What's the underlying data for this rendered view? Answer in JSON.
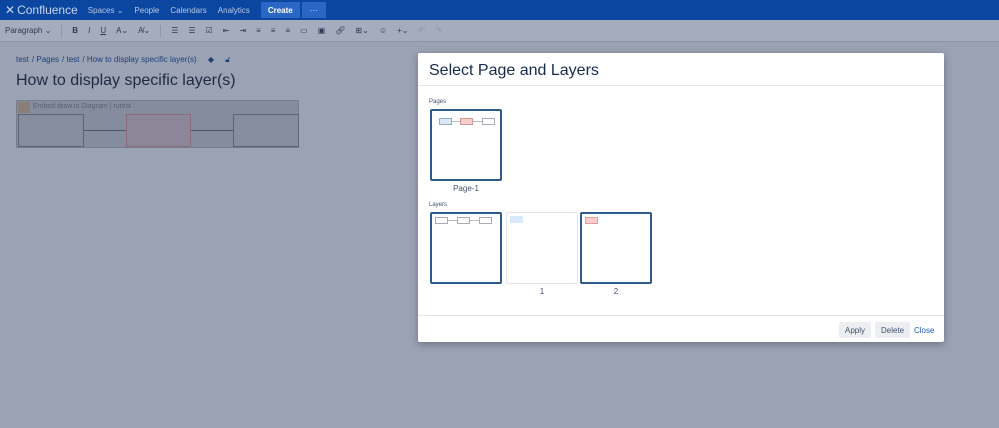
{
  "header": {
    "logo": "Confluence",
    "nav": [
      "Spaces",
      "People",
      "Calendars",
      "Analytics"
    ],
    "create": "Create",
    "more": "···"
  },
  "toolbar": {
    "paragraph": "Paragraph"
  },
  "breadcrumb": [
    "test",
    "Pages",
    "test",
    "How to display specific layer(s)"
  ],
  "page_title": "How to display specific layer(s)",
  "macro": {
    "label": "Embed draw.io Diagram",
    "sub": "| rutest"
  },
  "dialog": {
    "title": "Select Page and Layers",
    "pages_label": "Pages",
    "pages": [
      "Page-1"
    ],
    "layers_label": "Layers",
    "layers": [
      "",
      "1",
      "2"
    ],
    "apply": "Apply",
    "delete": "Delete",
    "close": "Close"
  }
}
